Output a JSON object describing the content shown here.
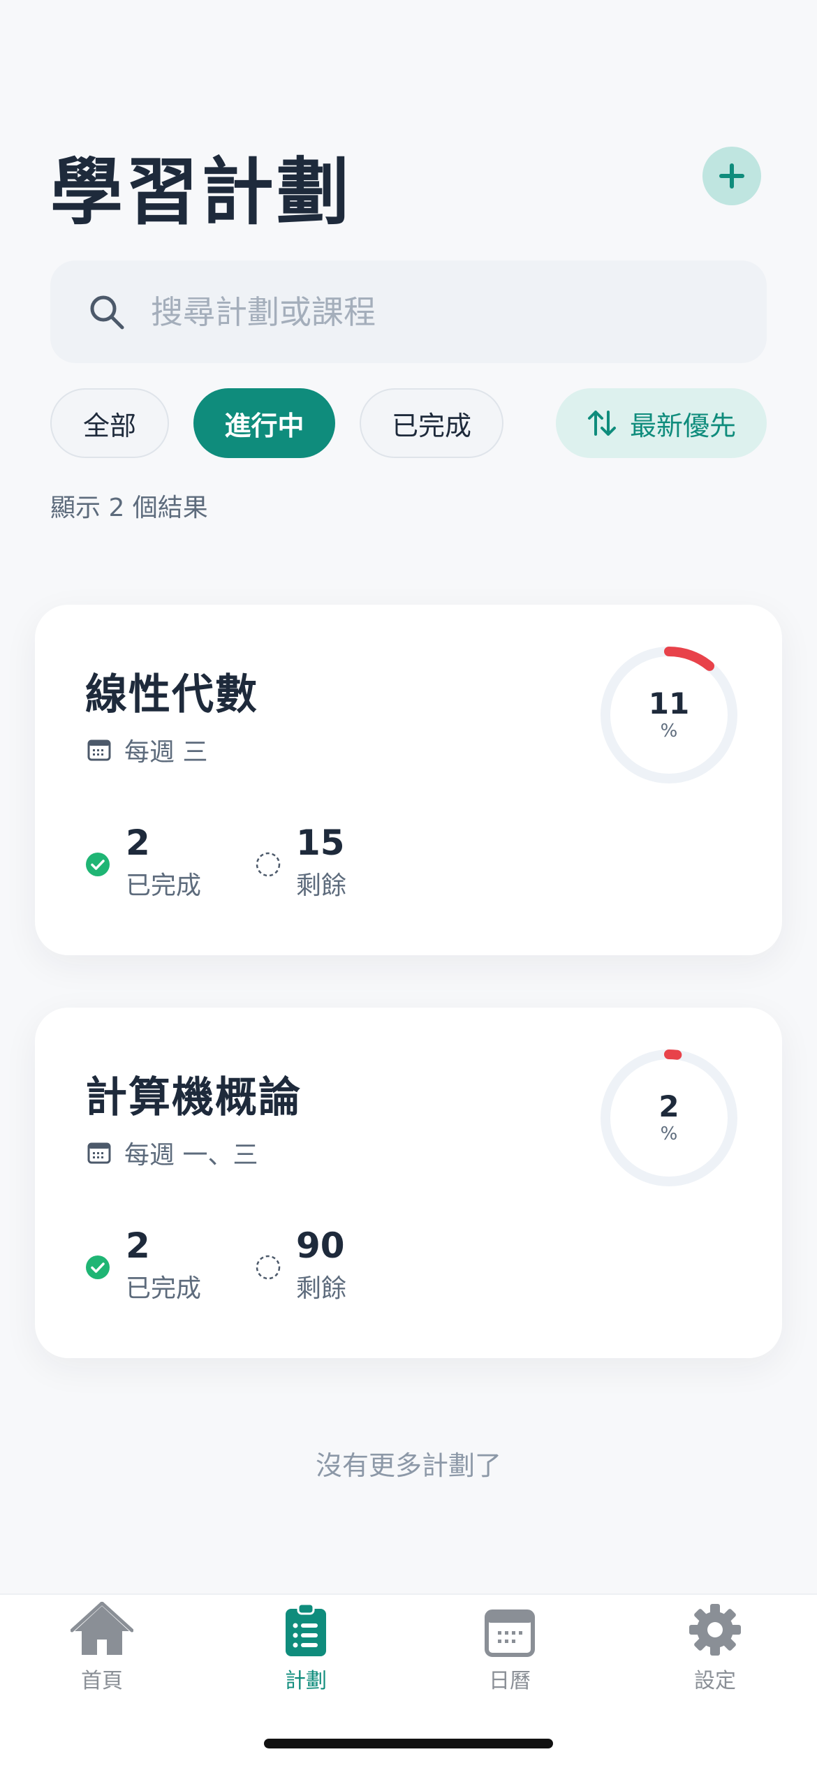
{
  "header": {
    "title": "學習計劃",
    "add_icon": "plus-icon"
  },
  "search": {
    "placeholder": "搜尋計劃或課程",
    "value": "",
    "icon": "search-icon"
  },
  "filters": {
    "chips": [
      {
        "label": "全部",
        "active": false
      },
      {
        "label": "進行中",
        "active": true
      },
      {
        "label": "已完成",
        "active": false
      }
    ],
    "sort_label": "最新優先",
    "sort_icon": "sort-arrows-icon"
  },
  "result_count": "顯示 2 個結果",
  "plans": [
    {
      "title": "線性代數",
      "schedule": "每週 三",
      "progress_percent": 11,
      "progress_value": "11",
      "percent_sign": "%",
      "completed": "2",
      "completed_label": "已完成",
      "remaining": "15",
      "remaining_label": "剩餘"
    },
    {
      "title": "計算機概論",
      "schedule": "每週 一、三",
      "progress_percent": 2,
      "progress_value": "2",
      "percent_sign": "%",
      "completed": "2",
      "completed_label": "已完成",
      "remaining": "90",
      "remaining_label": "剩餘"
    }
  ],
  "end_note": "沒有更多計劃了",
  "nav": {
    "items": [
      {
        "label": "首頁",
        "icon": "home-icon",
        "active": false
      },
      {
        "label": "計劃",
        "icon": "clipboard-list-icon",
        "active": true
      },
      {
        "label": "日曆",
        "icon": "calendar-icon",
        "active": false
      },
      {
        "label": "設定",
        "icon": "gear-icon",
        "active": false
      }
    ]
  },
  "colors": {
    "accent": "#0f8c7c",
    "accent_soft": "#ddf1ee",
    "progress": "#e8424a",
    "ring_track": "#eef2f7",
    "done_green": "#1fb574",
    "text_dark": "#1e2a3b",
    "text_muted": "#5d6b7c"
  }
}
